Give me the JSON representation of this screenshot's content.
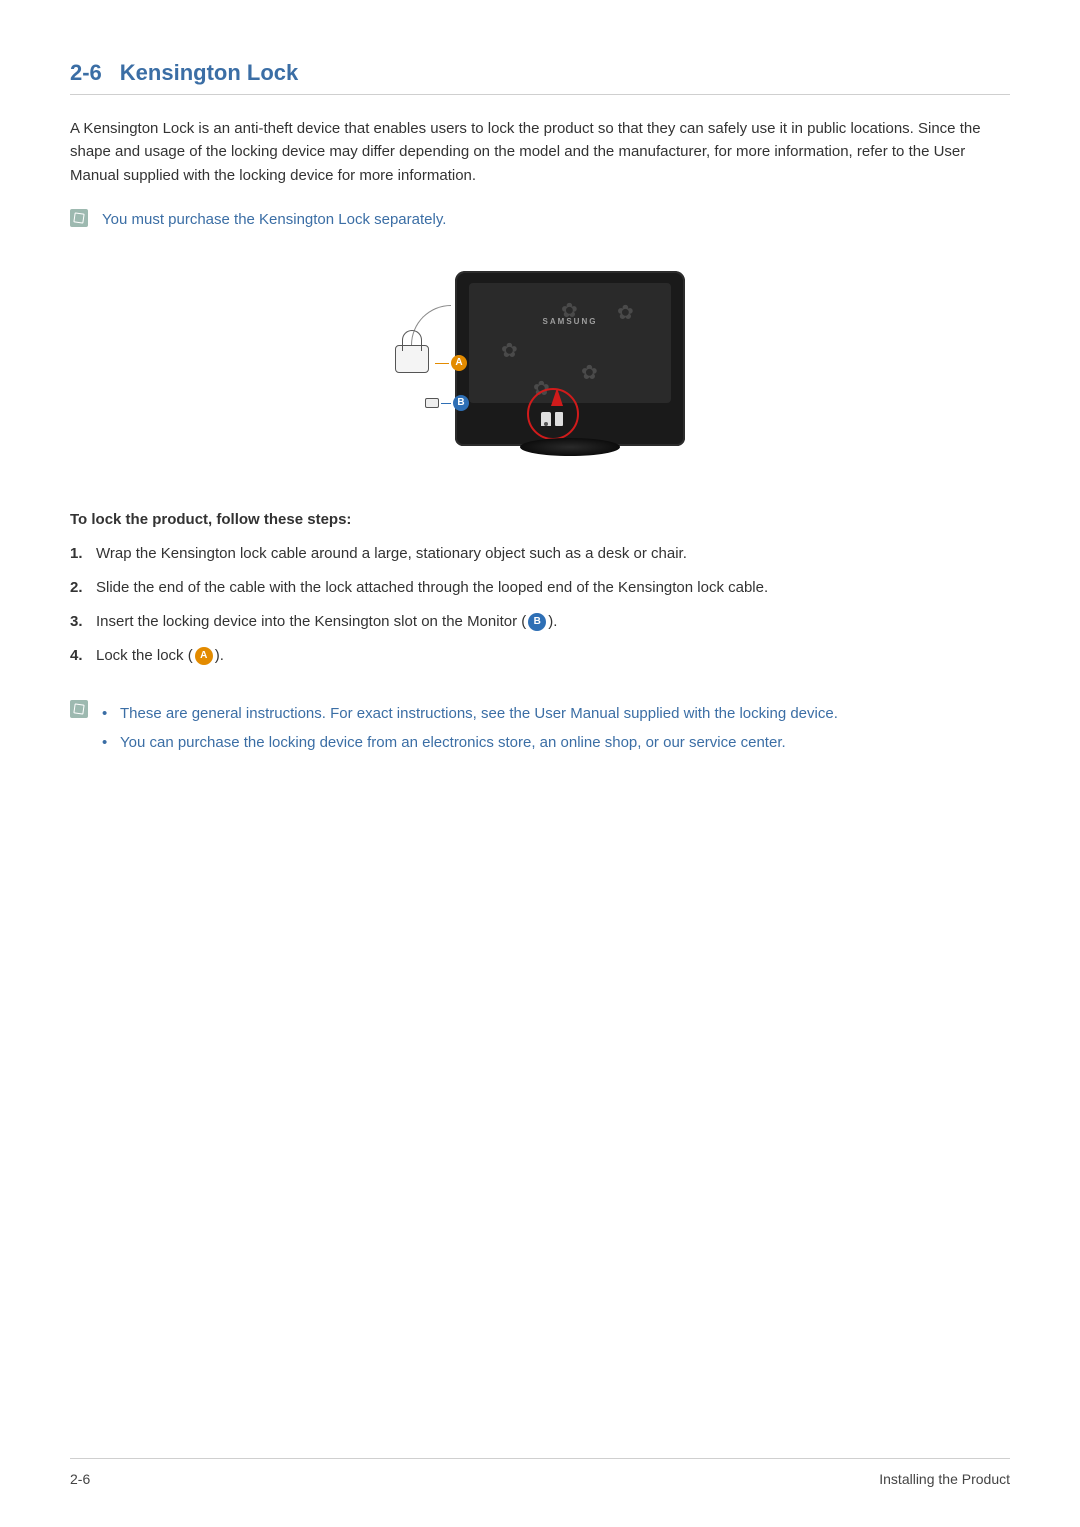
{
  "section": {
    "number": "2-6",
    "title": "Kensington Lock"
  },
  "intro": "A Kensington Lock is an anti-theft device that enables users to lock the product so that they can safely use it in public locations. Since the shape and usage of the locking device may differ depending on the model and the manufacturer, for more information, refer to the User Manual supplied with the locking device for more information.",
  "note1": "You must purchase the Kensington Lock separately.",
  "figure": {
    "brand": "SAMSUNG",
    "markerA": "A",
    "markerB": "B"
  },
  "steps_heading": "To lock the product, follow these steps:",
  "steps": [
    {
      "n": "1.",
      "text": "Wrap the Kensington lock cable around a large, stationary object such as a desk or chair."
    },
    {
      "n": "2.",
      "text": "Slide the end of the cable with the lock attached through the looped end of the Kensington lock cable."
    },
    {
      "n": "3.",
      "pre": "Insert the locking device into the Kensington slot on the Monitor (",
      "marker": "B",
      "post": ")."
    },
    {
      "n": "4.",
      "pre": "Lock the lock (",
      "marker": "A",
      "post": ")."
    }
  ],
  "note2": [
    "These are general instructions. For exact instructions, see the User Manual supplied with the locking device.",
    "You can purchase the locking device from an electronics store, an online shop, or our service center."
  ],
  "footer": {
    "left": "2-6",
    "right": "Installing the Product"
  }
}
